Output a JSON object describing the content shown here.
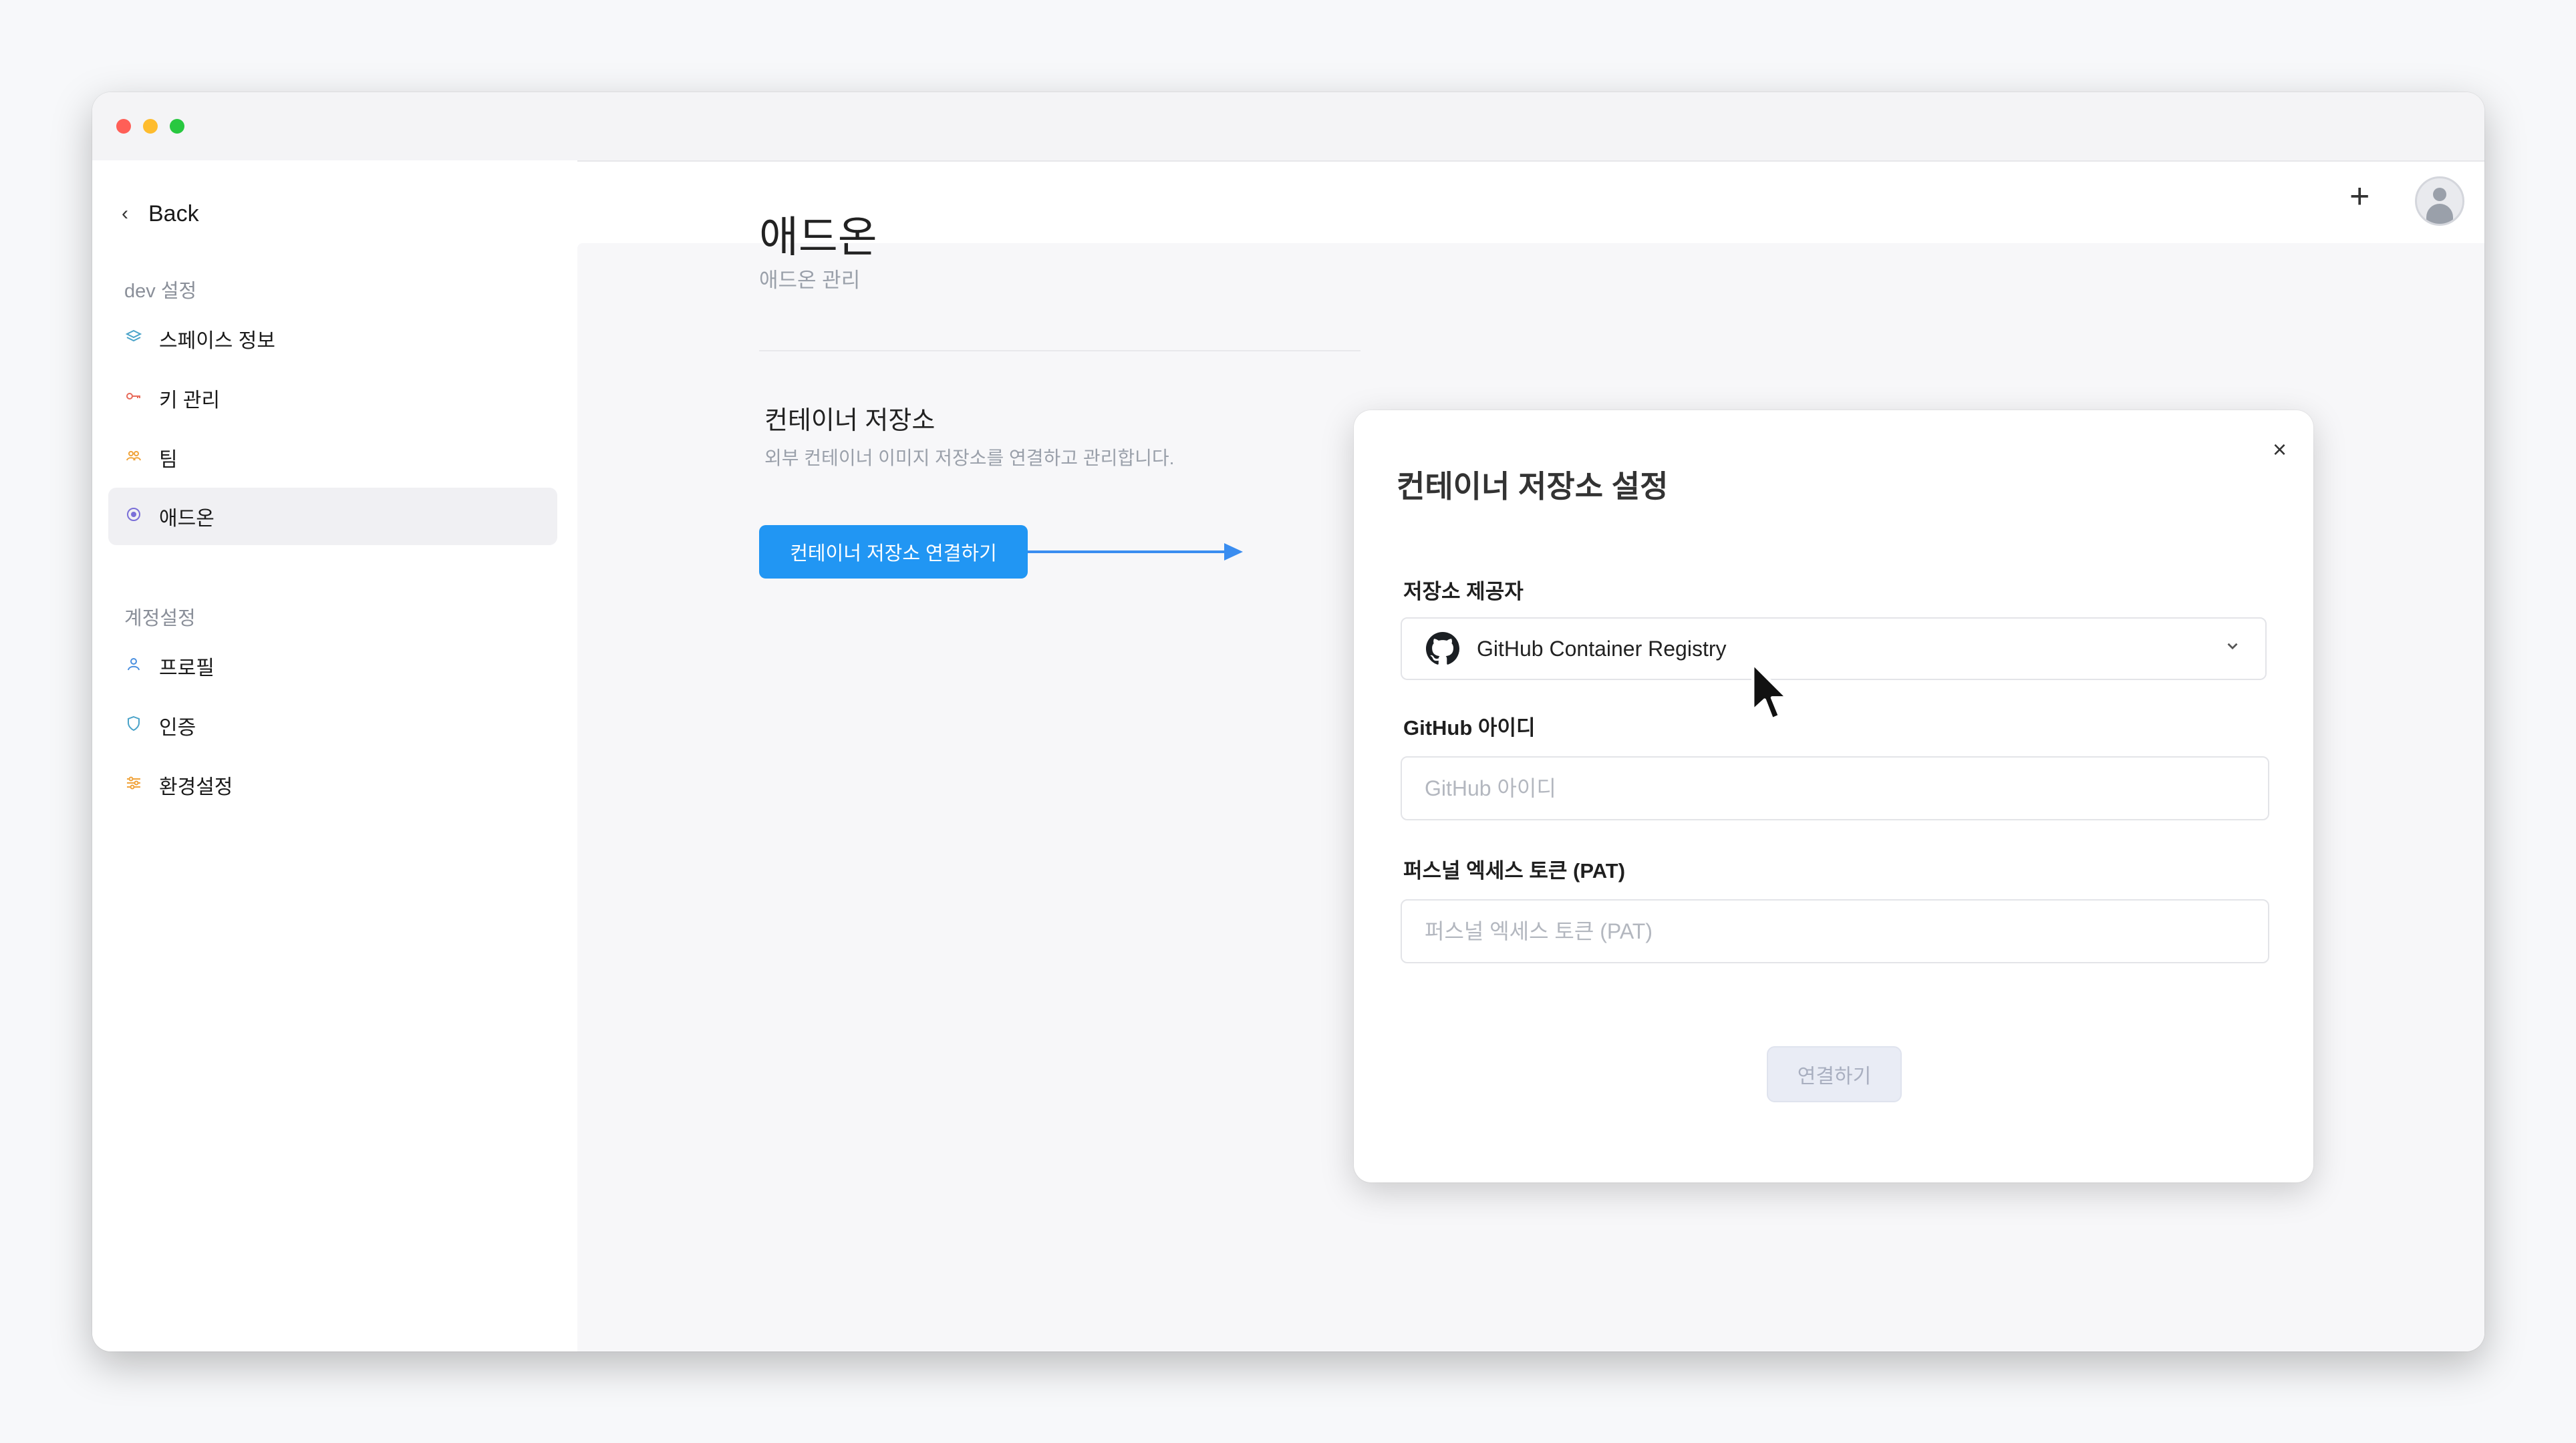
{
  "sidebar": {
    "back_label": "Back",
    "sections": [
      {
        "title": "dev 설정",
        "items": [
          {
            "label": "스페이스 정보",
            "icon": "layers-icon",
            "color": "#4aa3c9"
          },
          {
            "label": "키 관리",
            "icon": "key-icon",
            "color": "#e86a5a"
          },
          {
            "label": "팀",
            "icon": "team-icon",
            "color": "#f0a33a"
          },
          {
            "label": "애드온",
            "icon": "addon-icon",
            "color": "#7a6fd8",
            "active": true
          }
        ]
      },
      {
        "title": "계정설정",
        "items": [
          {
            "label": "프로필",
            "icon": "user-icon",
            "color": "#4a8fe0"
          },
          {
            "label": "인증",
            "icon": "shield-icon",
            "color": "#4aa3c9"
          },
          {
            "label": "환경설정",
            "icon": "sliders-icon",
            "color": "#f0a33a"
          }
        ]
      }
    ]
  },
  "header": {
    "plus_label": "+"
  },
  "main": {
    "title": "애드온",
    "subtitle": "애드온 관리",
    "card": {
      "title": "컨테이너 저장소",
      "description": "외부 컨테이너 이미지 저장소를 연결하고 관리합니다.",
      "button_label": "컨테이너 저장소 연결하기"
    }
  },
  "modal": {
    "title": "컨테이너 저장소 설정",
    "close_label": "×",
    "provider_label": "저장소 제공자",
    "provider_value": "GitHub Container Registry",
    "github_id_label": "GitHub 아이디",
    "github_id_placeholder": "GitHub 아이디",
    "github_id_value": "",
    "pat_label": "퍼스널 엑세스 토큰 (PAT)",
    "pat_placeholder": "퍼스널 엑세스 토큰 (PAT)",
    "pat_value": "",
    "connect_label": "연결하기"
  },
  "colors": {
    "accent": "#2196f3",
    "arrow": "#3a8df0",
    "disabled_button_bg": "#e9ecf5"
  }
}
